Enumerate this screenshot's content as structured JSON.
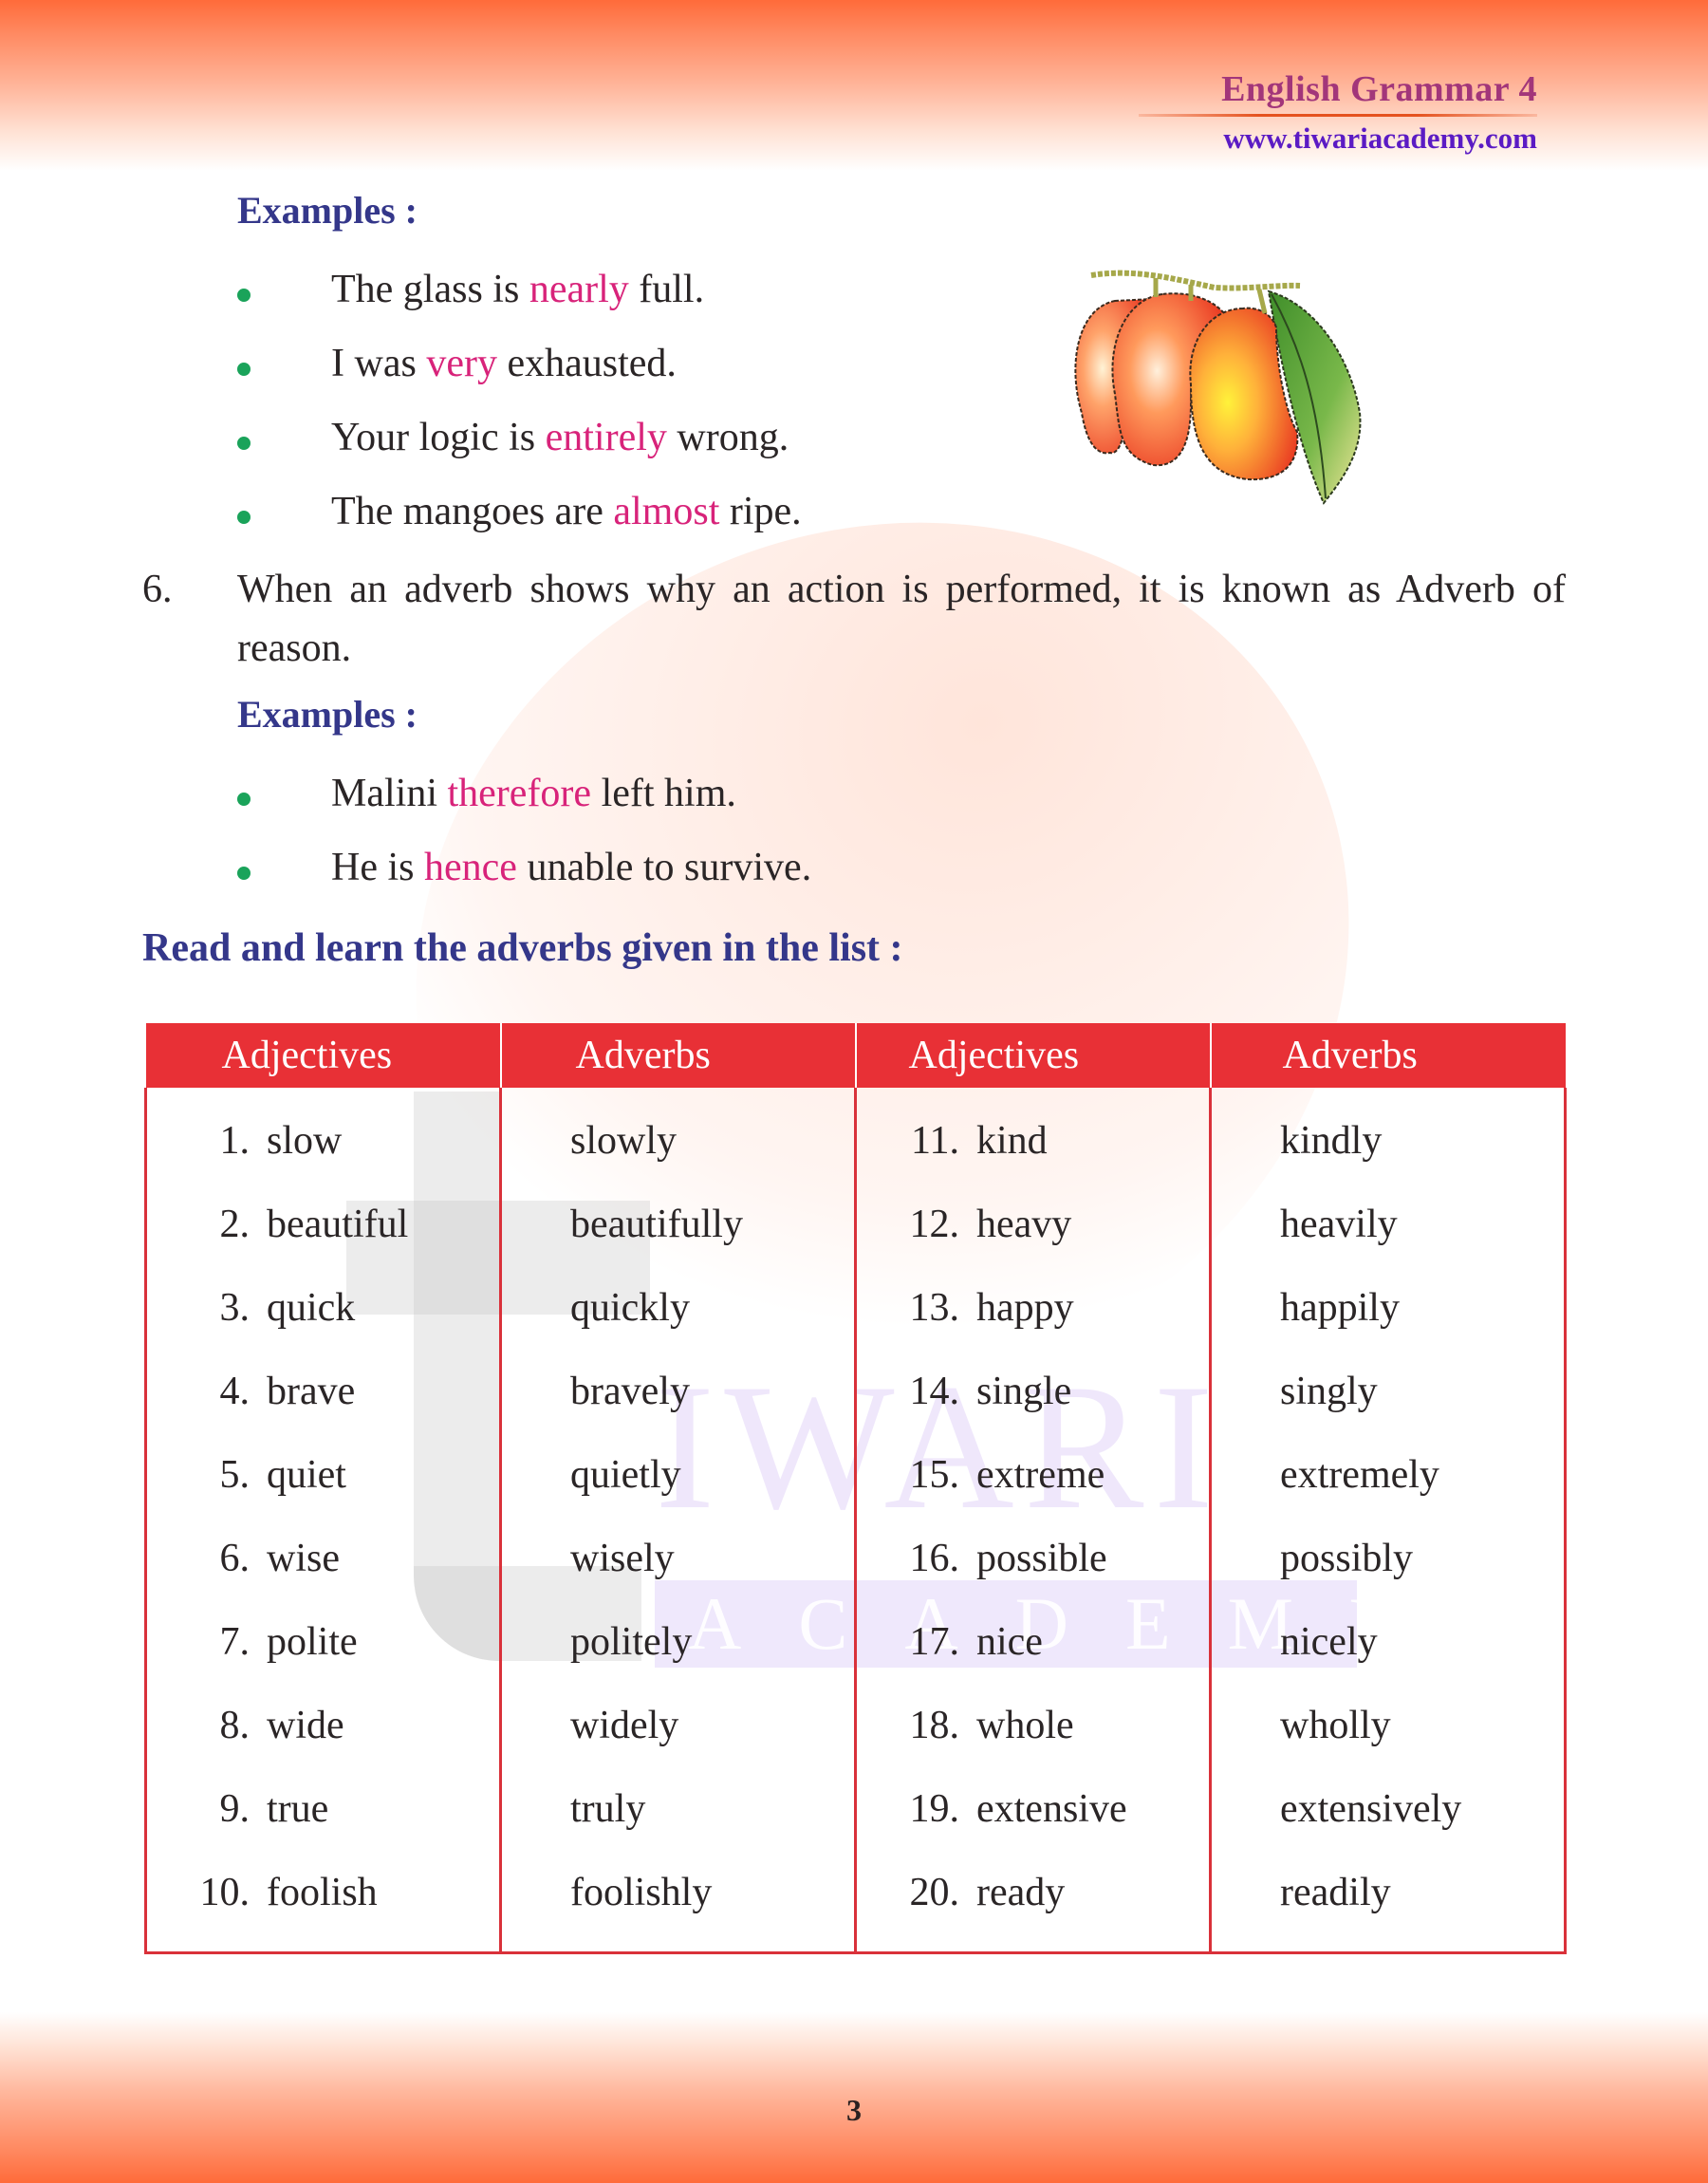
{
  "header": {
    "book_title": "English Grammar 4",
    "website": "www.tiwariacademy.com"
  },
  "watermark": {
    "word": "IWARI",
    "academy": "ACADEMY"
  },
  "colors": {
    "heading": "#34378a",
    "highlight": "#d8237a",
    "bullet": "#1aa35a",
    "table_header": "#e83036",
    "band": "#ff6b3a"
  },
  "examples_1": {
    "heading": "Examples :",
    "items": [
      {
        "before": "The glass is ",
        "adverb": "nearly",
        "after": " full."
      },
      {
        "before": "I was ",
        "adverb": "very",
        "after": " exhausted."
      },
      {
        "before": "Your logic is ",
        "adverb": "entirely",
        "after": " wrong."
      },
      {
        "before": "The mangoes are ",
        "adverb": "almost",
        "after": " ripe."
      }
    ]
  },
  "illustration": {
    "icon": "mango-illustration"
  },
  "point_6": {
    "number": "6.",
    "text": "When an adverb shows why an action is performed, it is known as Adverb of reason."
  },
  "examples_2": {
    "heading": "Examples :",
    "items": [
      {
        "before": "Malini ",
        "adverb": "therefore",
        "after": " left him."
      },
      {
        "before": "He is ",
        "adverb": "hence",
        "after": " unable to survive."
      }
    ]
  },
  "list_heading": "Read and learn the adverbs given in the list :",
  "table": {
    "headers": [
      "Adjectives",
      "Adverbs",
      "Adjectives",
      "Adverbs"
    ],
    "rows": [
      {
        "n1": "1.",
        "adj1": "slow",
        "adv1": "slowly",
        "n2": "11.",
        "adj2": "kind",
        "adv2": "kindly"
      },
      {
        "n1": "2.",
        "adj1": "beautiful",
        "adv1": "beautifully",
        "n2": "12.",
        "adj2": "heavy",
        "adv2": "heavily"
      },
      {
        "n1": "3.",
        "adj1": "quick",
        "adv1": "quickly",
        "n2": "13.",
        "adj2": "happy",
        "adv2": "happily"
      },
      {
        "n1": "4.",
        "adj1": "brave",
        "adv1": "bravely",
        "n2": "14.",
        "adj2": "single",
        "adv2": "singly"
      },
      {
        "n1": "5.",
        "adj1": "quiet",
        "adv1": "quietly",
        "n2": "15.",
        "adj2": "extreme",
        "adv2": "extremely"
      },
      {
        "n1": "6.",
        "adj1": "wise",
        "adv1": "wisely",
        "n2": "16.",
        "adj2": "possible",
        "adv2": "possibly"
      },
      {
        "n1": "7.",
        "adj1": "polite",
        "adv1": "politely",
        "n2": "17.",
        "adj2": "nice",
        "adv2": "nicely"
      },
      {
        "n1": "8.",
        "adj1": "wide",
        "adv1": "widely",
        "n2": "18.",
        "adj2": "whole",
        "adv2": "wholly"
      },
      {
        "n1": "9.",
        "adj1": "true",
        "adv1": "truly",
        "n2": "19.",
        "adj2": "extensive",
        "adv2": "extensively"
      },
      {
        "n1": "10.",
        "adj1": "foolish",
        "adv1": "foolishly",
        "n2": "20.",
        "adj2": "ready",
        "adv2": "readily"
      }
    ]
  },
  "footer": {
    "page_number": "3"
  }
}
